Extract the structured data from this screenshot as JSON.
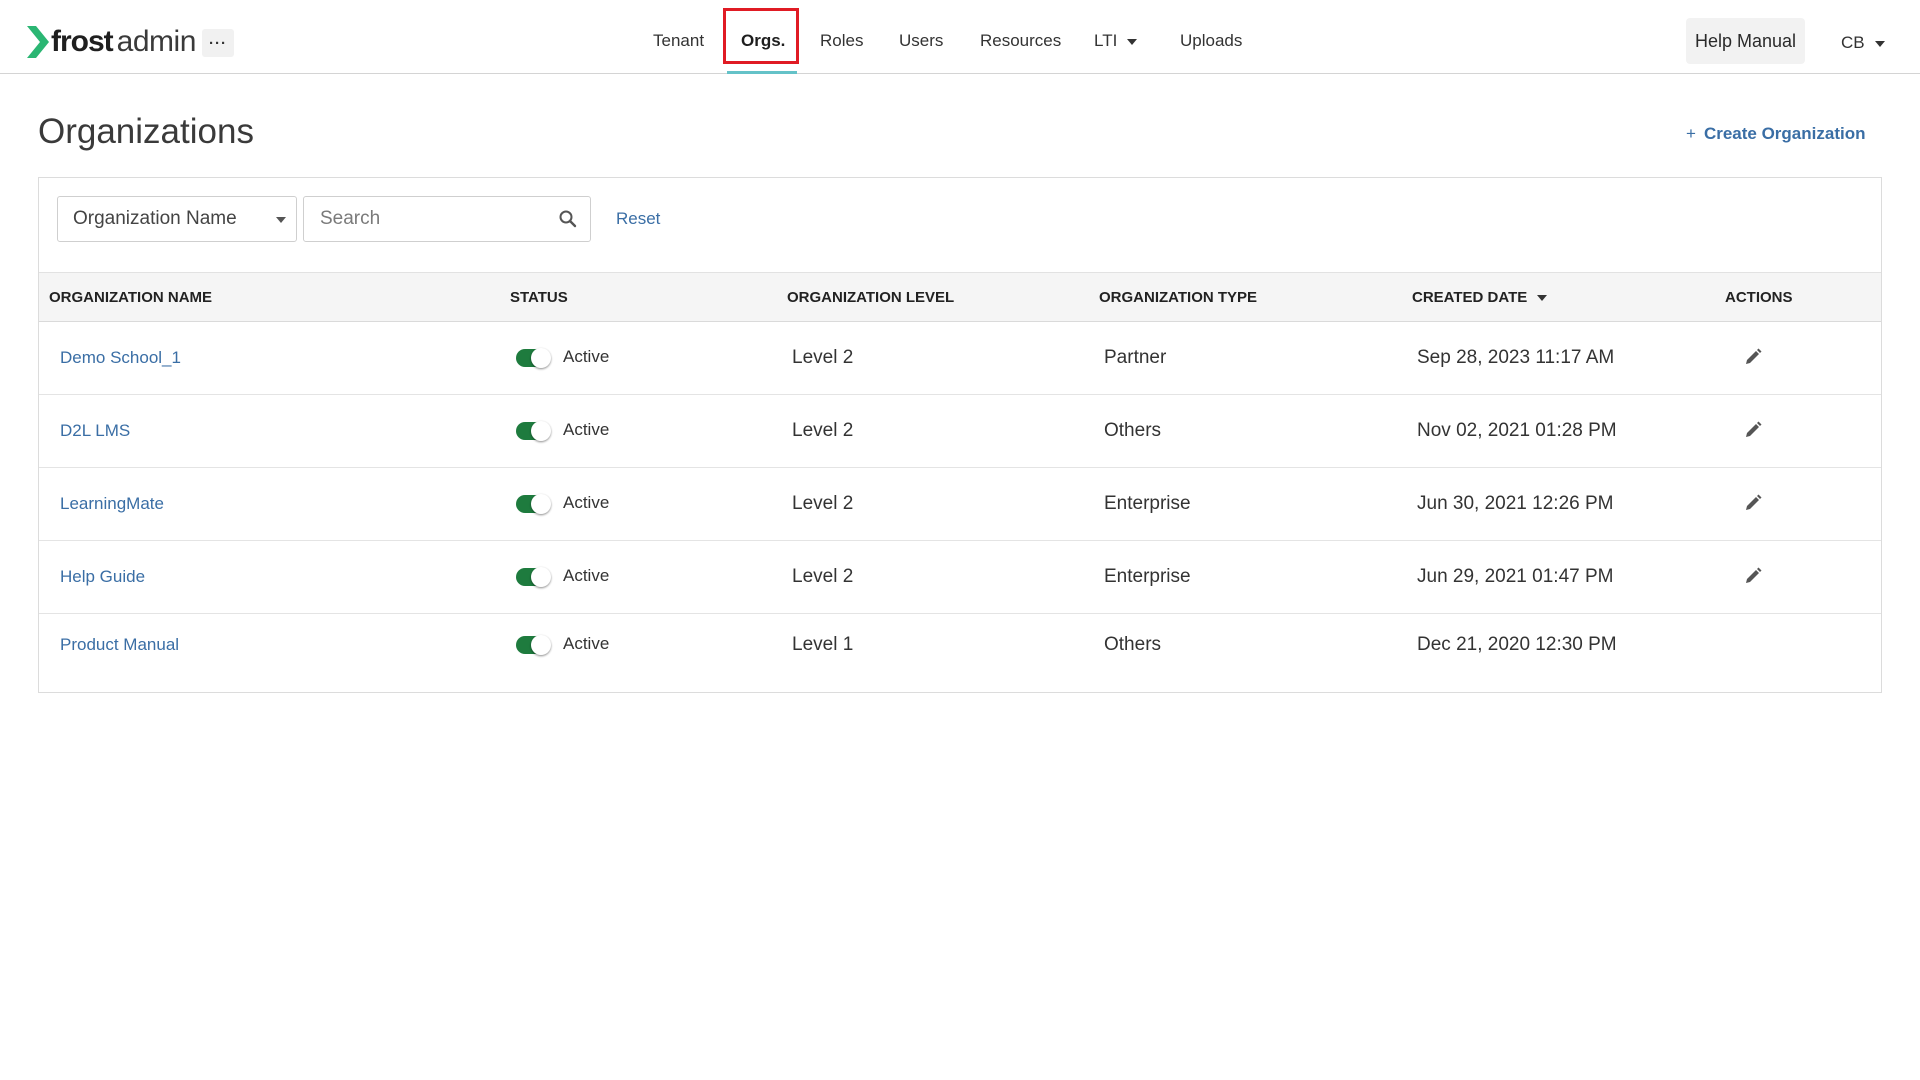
{
  "brand": {
    "name_bold": "frost",
    "name_light": "admin",
    "accent_color": "#2bb673"
  },
  "topbar": {
    "more_label": "···",
    "nav": [
      {
        "label": "Tenant",
        "active": false
      },
      {
        "label": "Orgs.",
        "active": true
      },
      {
        "label": "Roles",
        "active": false
      },
      {
        "label": "Users",
        "active": false
      },
      {
        "label": "Resources",
        "active": false
      },
      {
        "label": "LTI",
        "active": false,
        "has_dropdown": true
      },
      {
        "label": "Uploads",
        "active": false
      }
    ],
    "help_label": "Help Manual",
    "user_initials": "CB",
    "highlight_color": "#e01b24"
  },
  "page": {
    "title": "Organizations",
    "create_label": "Create Organization",
    "create_icon": "plus-icon"
  },
  "filters": {
    "field_select_value": "Organization Name",
    "search_placeholder": "Search",
    "search_value": "",
    "reset_label": "Reset"
  },
  "table": {
    "columns": [
      "ORGANIZATION NAME",
      "STATUS",
      "ORGANIZATION LEVEL",
      "ORGANIZATION TYPE",
      "CREATED DATE",
      "ACTIONS"
    ],
    "sorted_column": "CREATED DATE",
    "rows": [
      {
        "name": "Demo School_1",
        "status": "Active",
        "status_on": true,
        "level": "Level 2",
        "type": "Partner",
        "created": "Sep 28, 2023 11:17 AM",
        "editable": true
      },
      {
        "name": "D2L LMS",
        "status": "Active",
        "status_on": true,
        "level": "Level 2",
        "type": "Others",
        "created": "Nov 02, 2021 01:28 PM",
        "editable": true
      },
      {
        "name": "LearningMate",
        "status": "Active",
        "status_on": true,
        "level": "Level 2",
        "type": "Enterprise",
        "created": "Jun 30, 2021 12:26 PM",
        "editable": true
      },
      {
        "name": "Help Guide",
        "status": "Active",
        "status_on": true,
        "level": "Level 2",
        "type": "Enterprise",
        "created": "Jun 29, 2021 01:47 PM",
        "editable": true
      },
      {
        "name": "Product Manual",
        "status": "Active",
        "status_on": true,
        "level": "Level 1",
        "type": "Others",
        "created": "Dec 21, 2020 12:30 PM",
        "editable": false
      }
    ]
  }
}
